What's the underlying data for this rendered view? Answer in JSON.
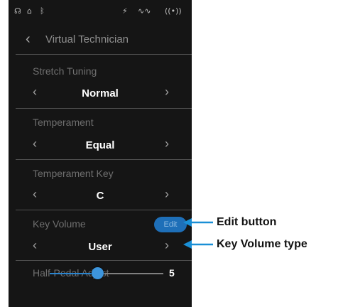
{
  "status_icons": [
    "headphones-icon",
    "usb-icon",
    "bluetooth-icon",
    "audio-icon",
    "mic-level-icon",
    "wireless-icon"
  ],
  "header": {
    "title": "Virtual Technician"
  },
  "settings": [
    {
      "label": "Stretch Tuning",
      "value": "Normal"
    },
    {
      "label": "Temperament",
      "value": "Equal"
    },
    {
      "label": "Temperament Key",
      "value": "C"
    },
    {
      "label": "Key Volume",
      "value": "User",
      "edit_label": "Edit"
    }
  ],
  "half_pedal": {
    "label": "Half-Pedal Adjust",
    "value": "5",
    "level_percent": 42
  },
  "callouts": {
    "edit": "Edit button",
    "type": "Key Volume type"
  },
  "colors": {
    "screen_bg": "#151515",
    "accent": "#1e6fb8",
    "callout_line": "#1a8fd6"
  }
}
